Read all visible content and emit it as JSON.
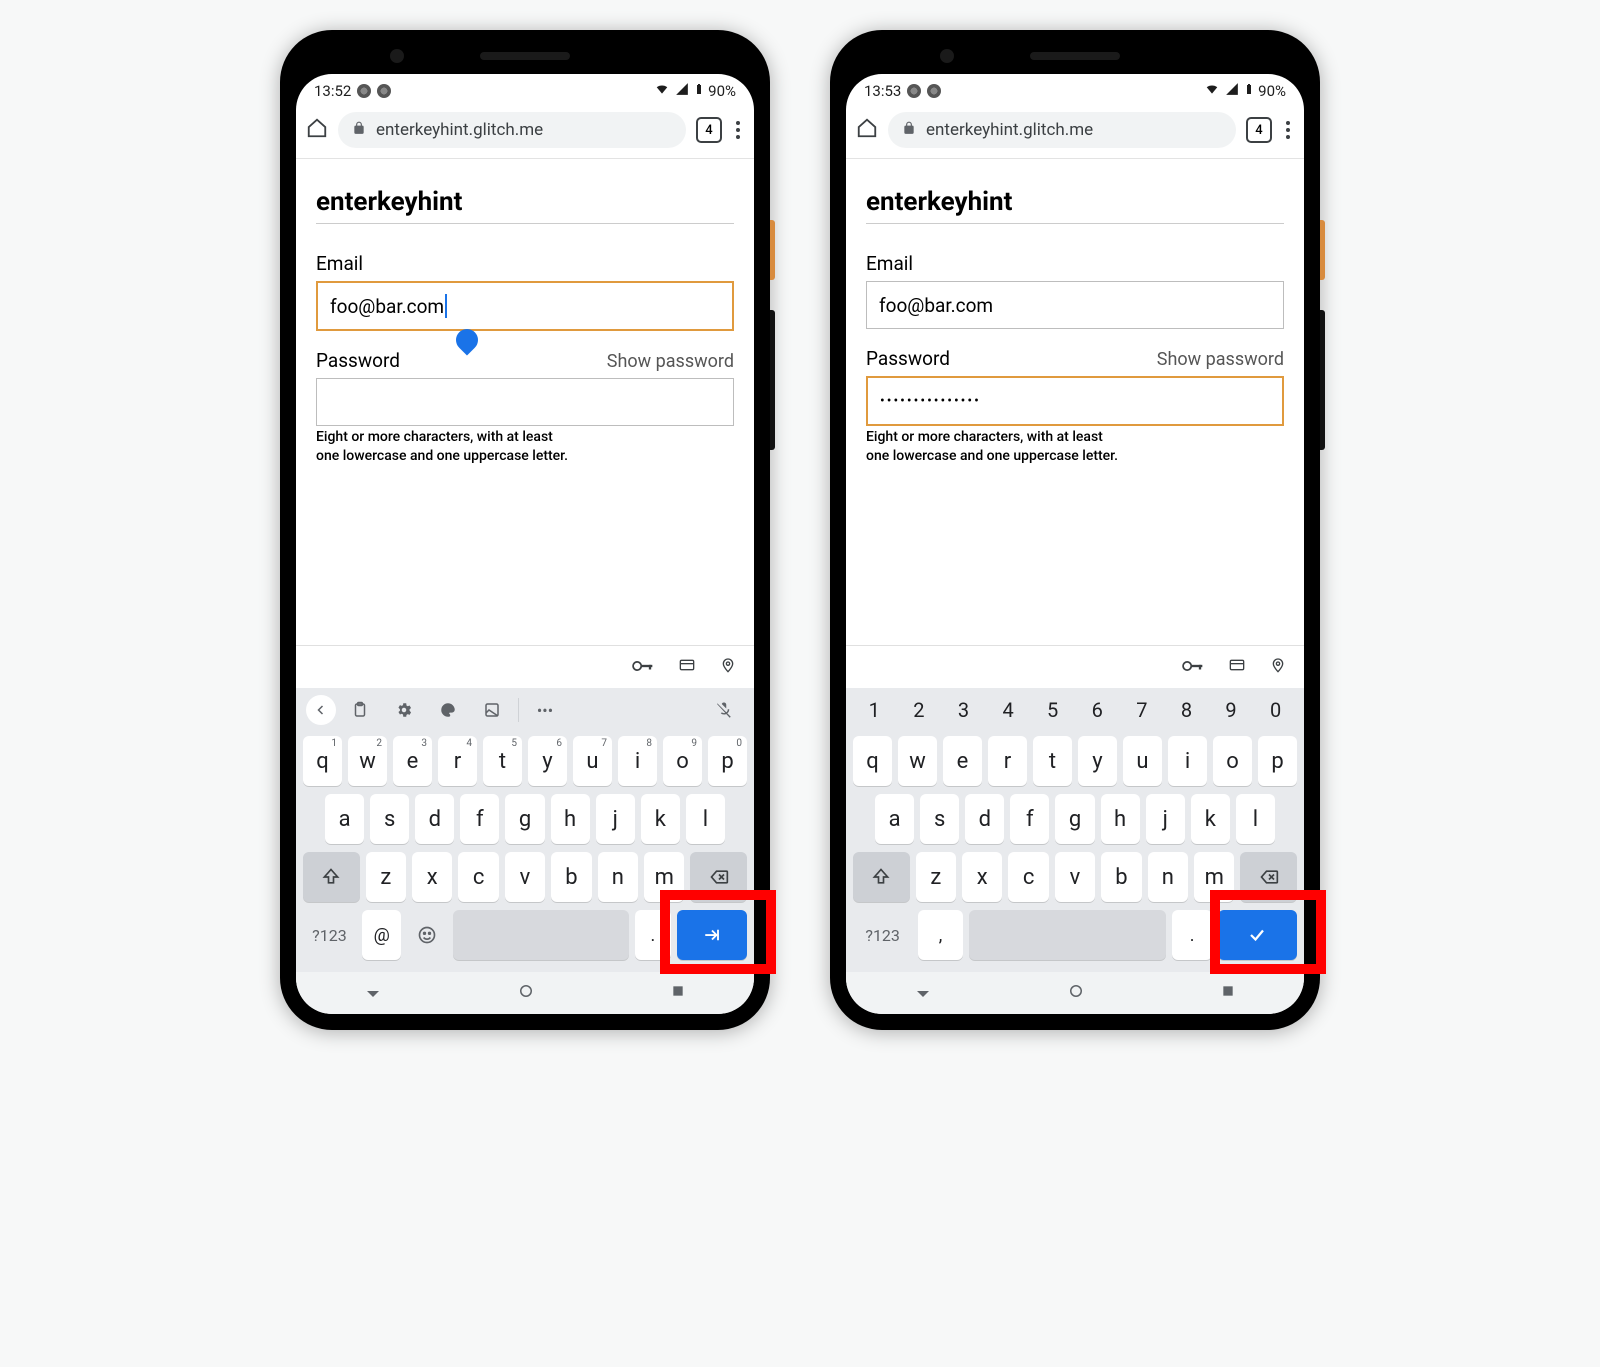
{
  "phones": [
    {
      "status": {
        "time": "13:52",
        "battery": "90%"
      },
      "omnibox": {
        "url": "enterkeyhint.glitch.me",
        "tab_count": "4"
      },
      "page": {
        "title": "enterkeyhint",
        "email_label": "Email",
        "email_value": "foo@bar.com",
        "email_active": true,
        "password_label": "Password",
        "show_password": "Show password",
        "password_value": "",
        "password_active": false,
        "hint_line1": "Eight or more characters, with at least",
        "hint_line2": "one lowercase and one uppercase letter."
      },
      "keyboard": {
        "variant": "email",
        "row1": [
          "q",
          "w",
          "e",
          "r",
          "t",
          "y",
          "u",
          "i",
          "o",
          "p"
        ],
        "row1_sup": [
          "1",
          "2",
          "3",
          "4",
          "5",
          "6",
          "7",
          "8",
          "9",
          "0"
        ],
        "row2": [
          "a",
          "s",
          "d",
          "f",
          "g",
          "h",
          "j",
          "k",
          "l"
        ],
        "row3": [
          "z",
          "x",
          "c",
          "v",
          "b",
          "n",
          "m"
        ],
        "sym_label": "?123",
        "at_key": "@",
        "dot_key": ".",
        "enter_icon": "next"
      }
    },
    {
      "status": {
        "time": "13:53",
        "battery": "90%"
      },
      "omnibox": {
        "url": "enterkeyhint.glitch.me",
        "tab_count": "4"
      },
      "page": {
        "title": "enterkeyhint",
        "email_label": "Email",
        "email_value": "foo@bar.com",
        "email_active": false,
        "password_label": "Password",
        "show_password": "Show password",
        "password_value": "•••••••••••••••",
        "password_active": true,
        "hint_line1": "Eight or more characters, with at least",
        "hint_line2": "one lowercase and one uppercase letter."
      },
      "keyboard": {
        "variant": "password",
        "nums": [
          "1",
          "2",
          "3",
          "4",
          "5",
          "6",
          "7",
          "8",
          "9",
          "0"
        ],
        "row1": [
          "q",
          "w",
          "e",
          "r",
          "t",
          "y",
          "u",
          "i",
          "o",
          "p"
        ],
        "row2": [
          "a",
          "s",
          "d",
          "f",
          "g",
          "h",
          "j",
          "k",
          "l"
        ],
        "row3": [
          "z",
          "x",
          "c",
          "v",
          "b",
          "n",
          "m"
        ],
        "sym_label": "?123",
        "comma_key": ",",
        "dot_key": ".",
        "enter_icon": "done"
      }
    }
  ]
}
